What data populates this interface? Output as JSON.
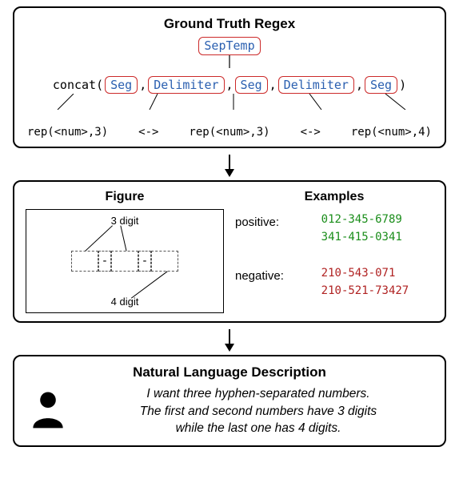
{
  "panel1": {
    "title": "Ground Truth Regex",
    "root_template": "SepTemp",
    "concat_prefix": "concat(",
    "concat_suffix": ")",
    "comma": ",",
    "parts": [
      {
        "label": "Seg",
        "expansion": "rep(<num>,3)"
      },
      {
        "label": "Delimiter",
        "expansion": "<->"
      },
      {
        "label": "Seg",
        "expansion": "rep(<num>,3)"
      },
      {
        "label": "Delimiter",
        "expansion": "<->"
      },
      {
        "label": "Seg",
        "expansion": "rep(<num>,4)"
      }
    ]
  },
  "panel2": {
    "figure_title": "Figure",
    "examples_title": "Examples",
    "figure": {
      "top_label": "3 digit",
      "bottom_label": "4 digit",
      "dash": "-"
    },
    "examples": {
      "positive_label": "positive:",
      "negative_label": "negative:",
      "positive": [
        "012-345-6789",
        "341-415-0341"
      ],
      "negative": [
        "210-543-071",
        "210-521-73427"
      ]
    }
  },
  "panel3": {
    "title": "Natural Language Description",
    "line1": "I want three hyphen-separated numbers.",
    "line2": "The first and second numbers have 3 digits",
    "line3": "while the last one has 4 digits."
  }
}
